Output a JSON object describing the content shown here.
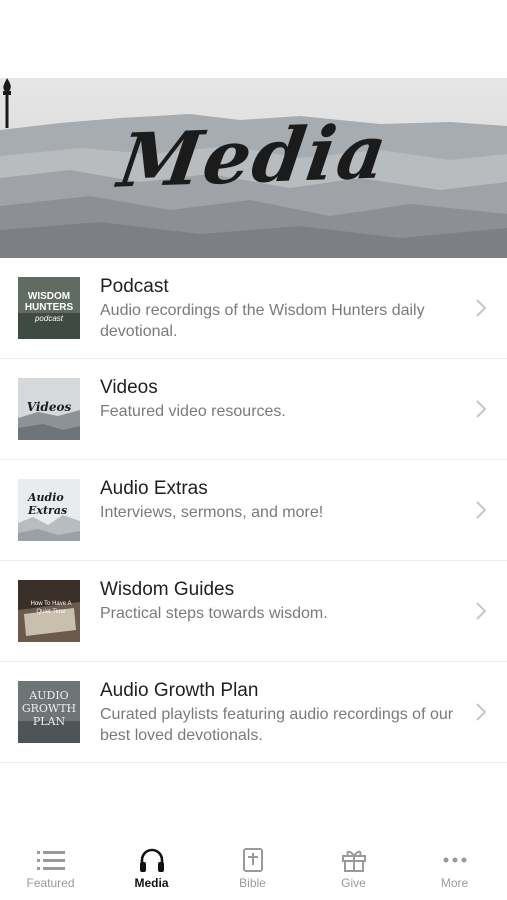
{
  "status_bar": {
    "time": ""
  },
  "hero": {
    "title": "Media"
  },
  "items": [
    {
      "title": "Podcast",
      "subtitle": "Audio recordings of the Wisdom Hunters daily devotional.",
      "thumb_text": [
        "WISDOM",
        "HUNTERS",
        "podcast"
      ]
    },
    {
      "title": "Videos",
      "subtitle": "Featured video resources.",
      "thumb_text": [
        "Videos"
      ]
    },
    {
      "title": "Audio Extras",
      "subtitle": "Interviews, sermons, and more!",
      "thumb_text": [
        "Audio",
        "Extras"
      ]
    },
    {
      "title": "Wisdom Guides",
      "subtitle": "Practical steps towards wisdom.",
      "thumb_text": [
        "How To Have A",
        "Quiet Time"
      ]
    },
    {
      "title": "Audio Growth Plan",
      "subtitle": "Curated playlists featuring audio recordings of our best loved devotionals.",
      "thumb_text": [
        "AUDIO",
        "GROWTH",
        "PLAN"
      ]
    }
  ],
  "tabs": [
    {
      "label": "Featured",
      "icon": "list-icon",
      "active": false
    },
    {
      "label": "Media",
      "icon": "headphones-icon",
      "active": true
    },
    {
      "label": "Bible",
      "icon": "bible-icon",
      "active": false
    },
    {
      "label": "Give",
      "icon": "gift-icon",
      "active": false
    },
    {
      "label": "More",
      "icon": "more-icon",
      "active": false
    }
  ],
  "colors": {
    "active_tab": "#111111",
    "inactive_tab": "#9a9a9a",
    "subtitle": "#7a7a7a",
    "divider": "#ececec"
  }
}
